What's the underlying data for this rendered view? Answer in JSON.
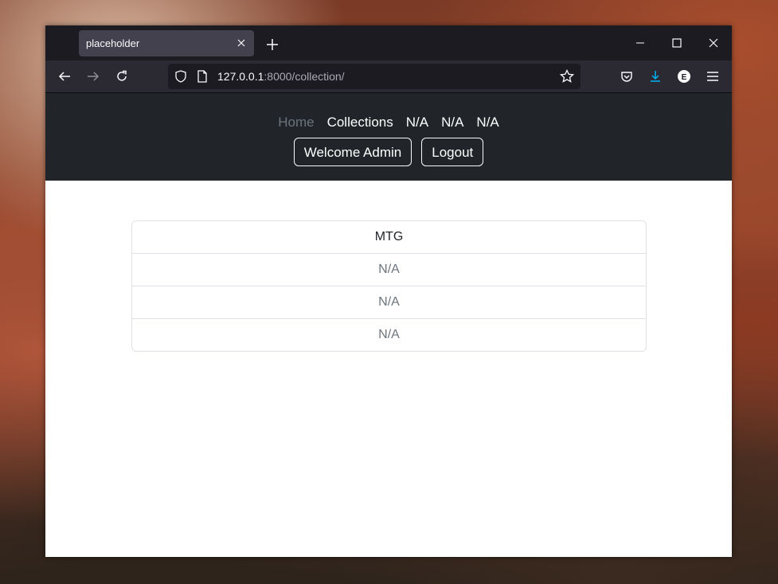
{
  "browser": {
    "tab_title": "placeholder",
    "url_host": "127.0.0.1",
    "url_rest": ":8000/collection/"
  },
  "site": {
    "nav": [
      "Home",
      "Collections",
      "N/A",
      "N/A",
      "N/A"
    ],
    "welcome_label": "Welcome Admin",
    "logout_label": "Logout"
  },
  "list": {
    "items": [
      "MTG",
      "N/A",
      "N/A",
      "N/A"
    ]
  },
  "colors": {
    "accent_download": "#00b3f4",
    "header_bg": "#212529"
  }
}
